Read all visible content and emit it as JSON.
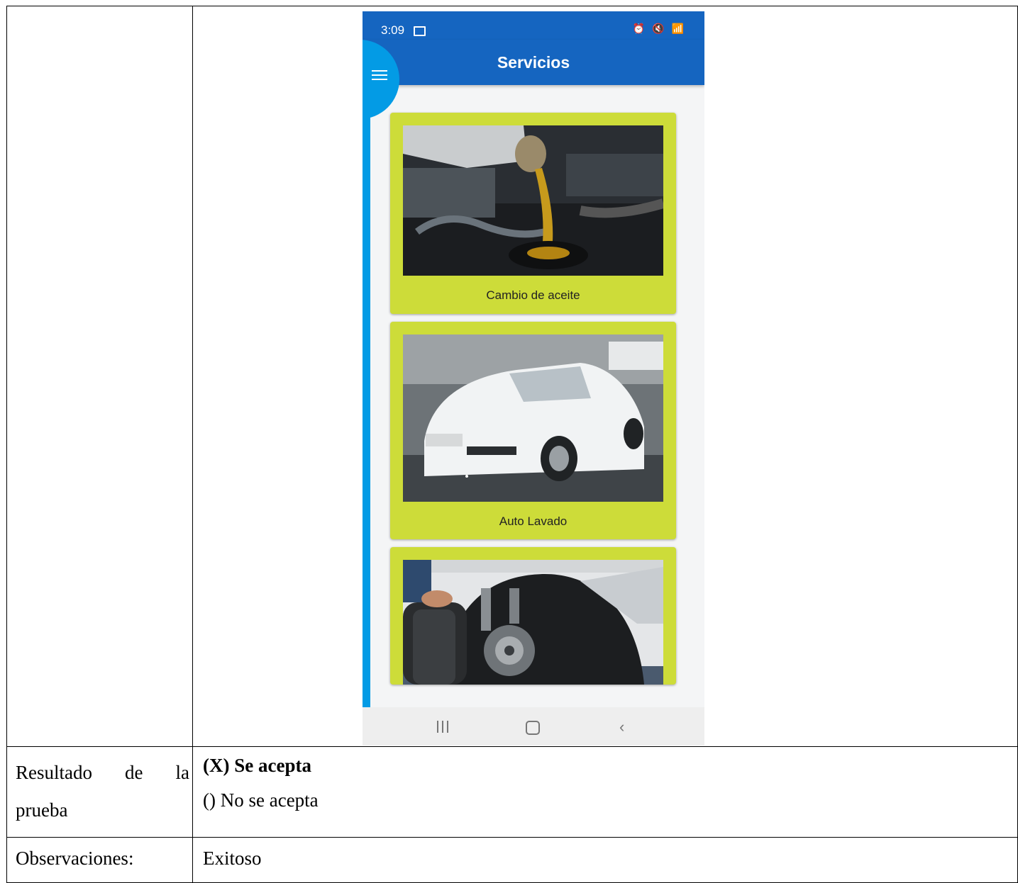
{
  "phone": {
    "status_time": "3:09",
    "status_icons": "⏰ 🔇 📶",
    "title": "Servicios",
    "services": [
      {
        "label": "Cambio de aceite",
        "image": "oil-change-photo"
      },
      {
        "label": "Auto Lavado",
        "image": "car-wash-photo"
      },
      {
        "label": "",
        "image": "tire-change-photo"
      }
    ],
    "colors": {
      "appbar": "#1565c0",
      "drawer": "#039be5",
      "card": "#cddc39"
    }
  },
  "table": {
    "result_label": "Resultado de la prueba",
    "result_accept": "(X) Se acepta",
    "result_reject": "() No se acepta",
    "obs_label": "Observaciones:",
    "obs_value": "Exitoso"
  }
}
